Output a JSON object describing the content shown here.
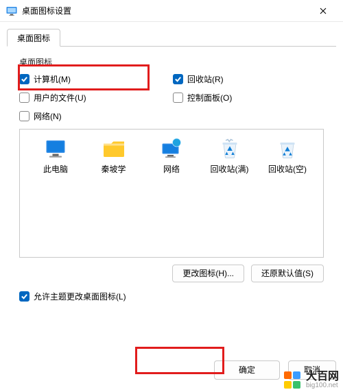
{
  "window": {
    "title": "桌面图标设置"
  },
  "tab": {
    "label": "桌面图标"
  },
  "section_label": "桌面图标",
  "checks": {
    "computer": {
      "label": "计算机(M)",
      "checked": true
    },
    "recycle": {
      "label": "回收站(R)",
      "checked": true
    },
    "userfiles": {
      "label": "用户的文件(U)",
      "checked": false
    },
    "ctrlpanel": {
      "label": "控制面板(O)",
      "checked": false
    },
    "network": {
      "label": "网络(N)",
      "checked": false
    }
  },
  "preview": {
    "thispc": {
      "label": "此电脑"
    },
    "qinpoxue": {
      "label": "秦坡学"
    },
    "network": {
      "label": "网络"
    },
    "recycle_full": {
      "label": "回收站(满)"
    },
    "recycle_empty": {
      "label": "回收站(空)"
    }
  },
  "buttons": {
    "change_icon": "更改图标(H)...",
    "restore_default": "还原默认值(S)",
    "ok": "确定",
    "cancel": "取消"
  },
  "allow_theme_label": "允许主题更改桌面图标(L)",
  "allow_theme_checked": true,
  "watermark": {
    "brand": "大百网",
    "url": "big100.net"
  }
}
